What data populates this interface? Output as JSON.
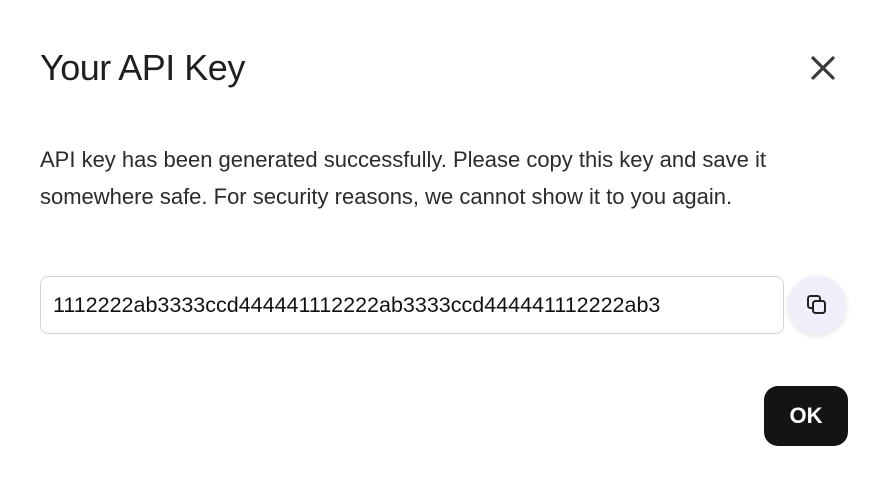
{
  "dialog": {
    "title": "Your API Key",
    "message": "API key has been generated successfully. Please copy this key and save it somewhere safe. For security reasons, we cannot show it to you again.",
    "api_key_value": "1112222ab3333ccd444441112222ab3333ccd444441112222ab3",
    "ok_label": "OK",
    "close_icon": "close-icon",
    "copy_icon": "copy-icon"
  },
  "colors": {
    "primary_button": "#141414",
    "copy_button_bg": "#efeff9",
    "text": "#1f1f1f"
  }
}
